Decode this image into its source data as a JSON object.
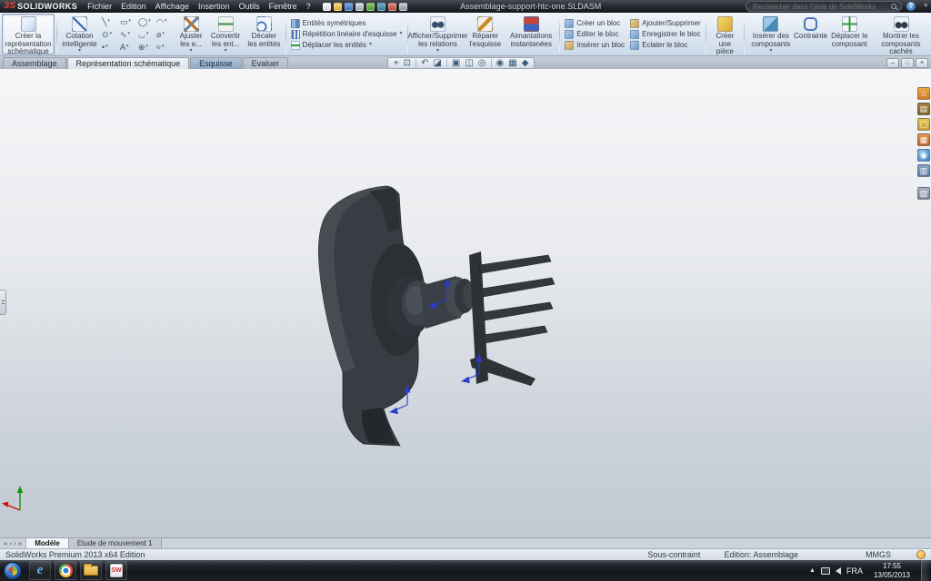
{
  "branding": {
    "ds_logo": "ЗS",
    "logo_mark": "ЗS",
    "logo_text": "SOLIDWORKS"
  },
  "titlebar": {
    "menus": [
      "Fichier",
      "Edition",
      "Affichage",
      "Insertion",
      "Outils",
      "Fenêtre",
      "?"
    ],
    "document_title": "Assemblage-support-htc-one.SLDASM",
    "search_placeholder": "Rechercher dans l'aide de SolidWorks"
  },
  "icons": {
    "caret": "▾",
    "help": "?",
    "minimize": "–",
    "restore": "□",
    "close": "×",
    "nav_first": "«",
    "nav_prev": "‹",
    "nav_next": "›",
    "nav_last": "»",
    "tray_expand": "▲",
    "ie": "e",
    "sw": "SW"
  },
  "ribbon": {
    "create_schematic": "Créer la représentation schématique",
    "smart_dimension": "Cotation intelligente",
    "sketch_tools": [
      {
        "name": "line-tool",
        "glyph": "╲"
      },
      {
        "name": "rectangle-tool",
        "glyph": "▭"
      },
      {
        "name": "circle-tool",
        "glyph": "◯"
      },
      {
        "name": "arc-tool",
        "glyph": "◠"
      },
      {
        "name": "ellipse-tool",
        "glyph": "⊙"
      },
      {
        "name": "spline-tool",
        "glyph": "∿"
      },
      {
        "name": "fillet-tool",
        "glyph": "◡"
      },
      {
        "name": "slot-tool",
        "glyph": "⌀"
      },
      {
        "name": "point-tool",
        "glyph": "•"
      },
      {
        "name": "text-tool",
        "glyph": "A"
      },
      {
        "name": "pattern-tool",
        "glyph": "⊕"
      },
      {
        "name": "construction-tool",
        "glyph": "≈"
      }
    ],
    "trim": "Ajuster les e...",
    "convert": "Convertir les ent...",
    "offset": "Décaler les entités",
    "mirror": "Entités symétriques",
    "linear_pattern": "Répétition linéaire d'esquisse",
    "move_entities": "Déplacer les entités",
    "display_relations": "Afficher/Supprimer les relations",
    "repair_sketch": "Réparer l'esquisse",
    "instant_snaps": "Aimantations instantanées",
    "make_block": "Créer un bloc",
    "edit_block": "Editer le bloc",
    "insert_block": "Insérer un bloc",
    "add_remove": "Ajouter/Supprimer",
    "save_block": "Enregistrer le bloc",
    "explode_block": "Eclater le bloc",
    "create_part": "Créer une pièce",
    "insert_components": "Insérer des composants",
    "mate": "Contrainte",
    "move_component": "Déplacer le composant",
    "show_hidden": "Montrer les composants cachés"
  },
  "tabs": [
    {
      "label": "Assemblage"
    },
    {
      "label": "Représentation schématique"
    },
    {
      "label": "Esquisse"
    },
    {
      "label": "Evaluer"
    }
  ],
  "viewport": {
    "hud": [
      {
        "name": "zoom-to-fit",
        "glyph": "⌖"
      },
      {
        "name": "zoom-to-area",
        "glyph": "⊡"
      },
      {
        "name": "previous-view",
        "glyph": "↶"
      },
      {
        "name": "section-view",
        "glyph": "◪"
      },
      {
        "name": "view-orientation",
        "glyph": "▣"
      },
      {
        "name": "display-style",
        "glyph": "◫"
      },
      {
        "name": "hide-show-items",
        "glyph": "◎"
      },
      {
        "name": "edit-appearance",
        "glyph": "◉"
      },
      {
        "name": "apply-scene",
        "glyph": "▦"
      },
      {
        "name": "view-settings",
        "glyph": "◆"
      }
    ],
    "taskpane": [
      {
        "name": "solidworks-resources",
        "glyph": "⌂"
      },
      {
        "name": "design-library",
        "glyph": "▤"
      },
      {
        "name": "file-explorer",
        "glyph": "▢"
      },
      {
        "name": "view-palette",
        "glyph": "▦"
      },
      {
        "name": "appearances-scenes",
        "glyph": "◉"
      },
      {
        "name": "custom-properties",
        "glyph": "▥"
      },
      {
        "name": "document-recovery",
        "glyph": "▧"
      }
    ]
  },
  "bottom_tabs": {
    "model": "Modèle",
    "motion_study": "Etude de mouvement 1"
  },
  "statusbar": {
    "edition": "SolidWorks Premium 2013 x64 Edition",
    "constraint_status": "Sous-contraint",
    "mode": "Edition: Assemblage",
    "units": "MMGS"
  },
  "taskbar": {
    "language": "FRA",
    "time": "17:55",
    "date": "13/05/2013"
  }
}
